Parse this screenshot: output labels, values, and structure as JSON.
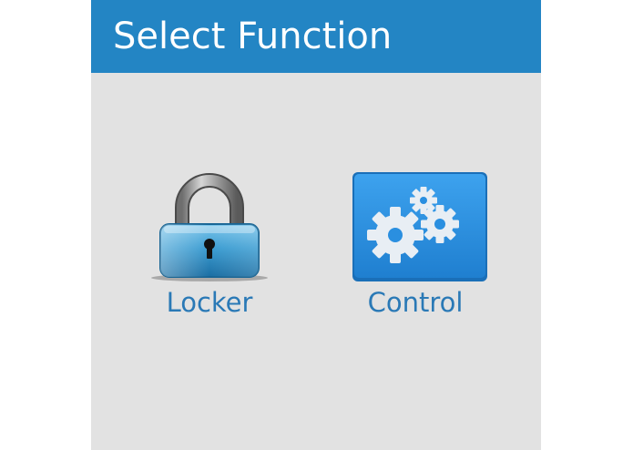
{
  "header": {
    "title": "Select Function"
  },
  "functions": [
    {
      "label": "Locker",
      "icon": "padlock-icon"
    },
    {
      "label": "Control",
      "icon": "gears-icon"
    }
  ],
  "colors": {
    "header_bg": "#2385c4",
    "panel_bg": "#e2e2e2",
    "label_text": "#2a79b6",
    "control_tile": "#2a8fe0"
  }
}
